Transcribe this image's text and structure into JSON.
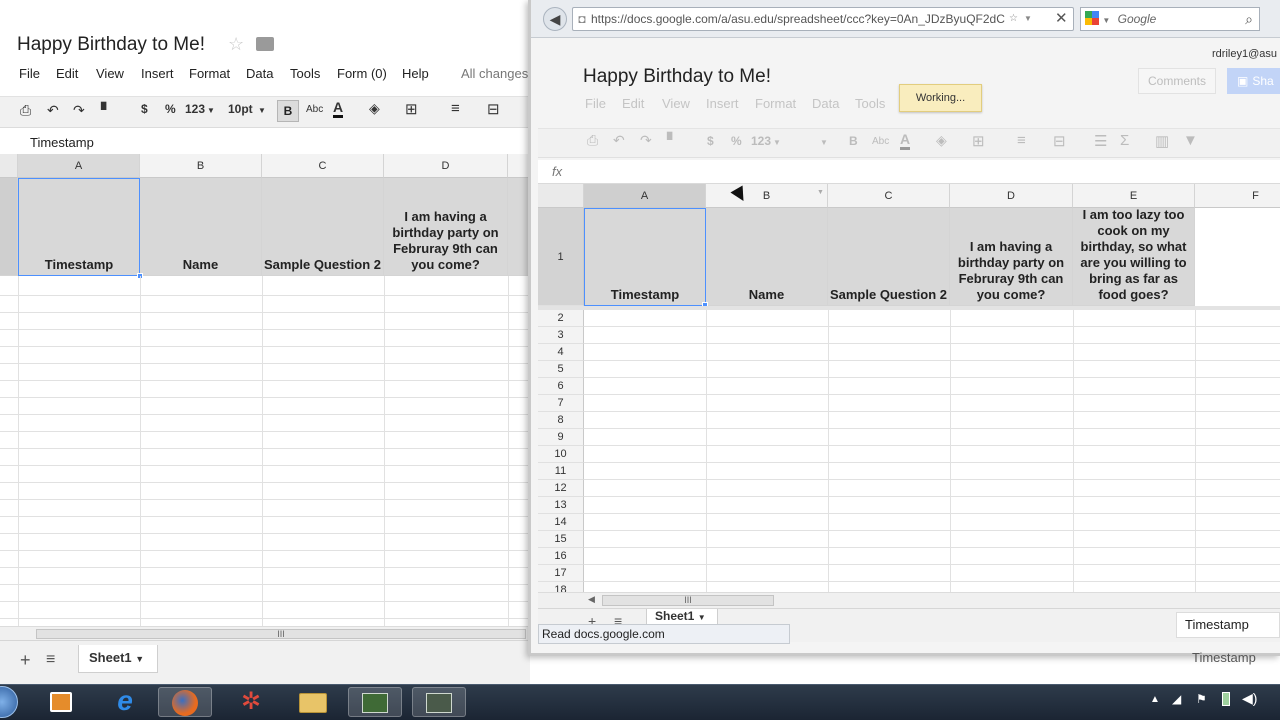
{
  "background_doc": {
    "title": "Happy Birthday to Me!",
    "menu": [
      "File",
      "Edit",
      "View",
      "Insert",
      "Format",
      "Data",
      "Tools",
      "Form (0)",
      "Help"
    ],
    "save_status": "All changes",
    "toolbar": {
      "currency": "$",
      "percent": "%",
      "number_format": "123",
      "font_size": "10pt",
      "bold": "B",
      "strike": "Abc",
      "text_color": "A"
    },
    "formula_value": "Timestamp",
    "columns": [
      "A",
      "B",
      "C",
      "D"
    ],
    "headers": [
      "Timestamp",
      "Name",
      "Sample Question 2",
      "I am having a birthday party on Februray 9th can you come?"
    ],
    "sheet_tab": "Sheet1"
  },
  "browser": {
    "url": "https://docs.google.com/a/asu.edu/spreadsheet/ccc?key=0An_JDzByuQF2dC",
    "search_engine": "Google",
    "user": "rdriley1@asu"
  },
  "foreground_doc": {
    "title": "Happy Birthday to Me!",
    "menu": [
      "File",
      "Edit",
      "View",
      "Insert",
      "Format",
      "Data",
      "Tools"
    ],
    "working_label": "Working...",
    "comments_label": "Comments",
    "share_label": "Sha",
    "toolbar": {
      "currency": "$",
      "percent": "%",
      "number_format": "123",
      "bold": "B",
      "strike": "Abc",
      "text_color": "A"
    },
    "fx_label": "fx",
    "columns": [
      "A",
      "B",
      "C",
      "D",
      "E",
      "F"
    ],
    "headers": [
      "Timestamp",
      "Name",
      "Sample Question 2",
      "I am having a birthday party on Februray 9th can you come?",
      "I am too lazy too cook on my birthday, so what are you willing to bring as far as food goes?"
    ],
    "row_numbers": [
      "1",
      "2",
      "3",
      "4",
      "5",
      "6",
      "7",
      "8",
      "9",
      "10",
      "11",
      "12",
      "13",
      "14",
      "15",
      "16",
      "17",
      "18"
    ],
    "sheet_tab": "Sheet1",
    "status_text": "Read docs.google.com",
    "tooltip": "Timestamp",
    "tooltip_shadow": "Timestamp"
  },
  "colors": {
    "accent": "#4d90fe",
    "taskbar": "#1f2a38",
    "working_bg": "#f9edbe"
  }
}
